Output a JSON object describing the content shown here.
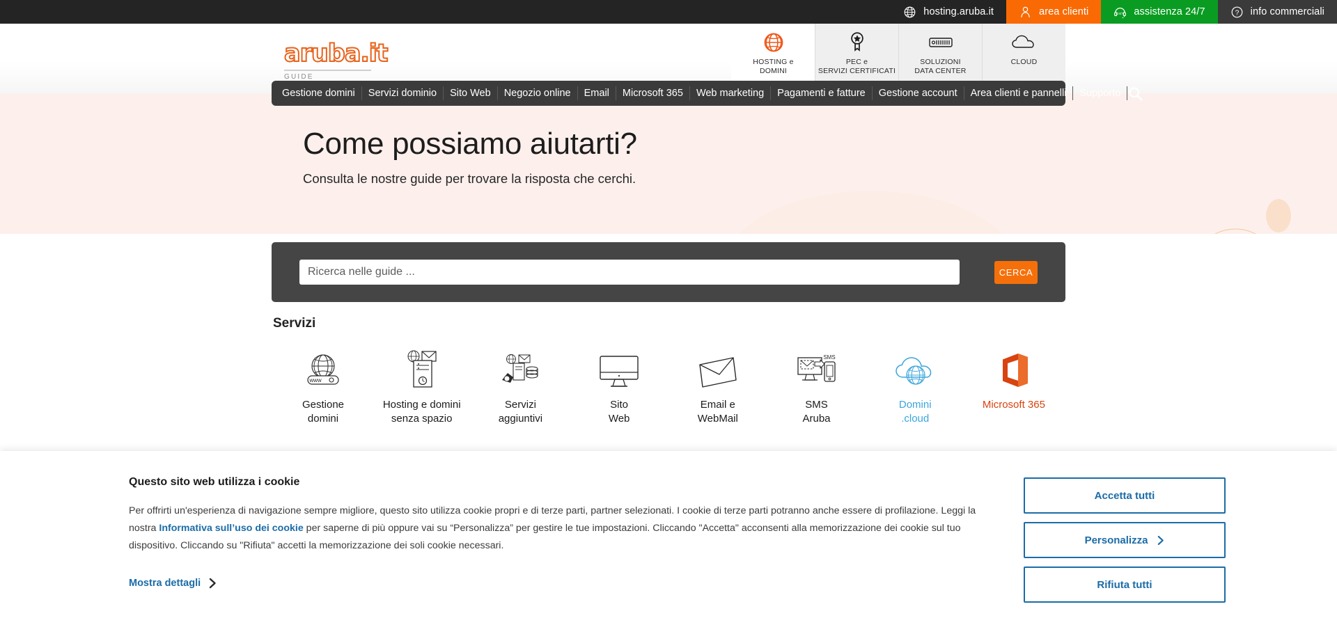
{
  "topbar": {
    "items": [
      {
        "label": "hosting.aruba.it",
        "icon": "globe-icon",
        "style": "tb-dark"
      },
      {
        "label": "area clienti",
        "icon": "user-icon",
        "style": "tb-orange"
      },
      {
        "label": "assistenza 24/7",
        "icon": "headset-icon",
        "style": "tb-green"
      },
      {
        "label": "info commerciali",
        "icon": "question-icon",
        "style": "tb-dark2"
      }
    ]
  },
  "header": {
    "logo": "aruba.it",
    "logo_subtitle": "GUIDE",
    "categories": [
      {
        "line1": "HOSTING e",
        "line2": "DOMINI",
        "icon": "globe-grid-icon",
        "active": true
      },
      {
        "line1": "PEC e",
        "line2": "SERVIZI CERTIFICATI",
        "icon": "seal-star-icon",
        "active": false
      },
      {
        "line1": "SOLUZIONI",
        "line2": "DATA CENTER",
        "icon": "server-rack-icon",
        "active": false
      },
      {
        "line1": "CLOUD",
        "line2": "",
        "icon": "cloud-icon",
        "active": false
      }
    ]
  },
  "menu": {
    "items": [
      "Gestione domini",
      "Servizi dominio",
      "Sito Web",
      "Negozio online",
      "Email",
      "Microsoft 365",
      "Web marketing",
      "Pagamenti e fatture",
      "Gestione account",
      "Area clienti e pannelli",
      "Supporto"
    ],
    "search_icon": "search-icon"
  },
  "hero": {
    "title": "Come possiamo aiutarti?",
    "subtitle": "Consulta le nostre guide per trovare la risposta che cerchi."
  },
  "search": {
    "placeholder": "Ricerca nelle guide ...",
    "value": "",
    "button_label": "CERCA"
  },
  "services": {
    "title": "Servizi",
    "items": [
      {
        "line1": "Gestione",
        "line2": "domini",
        "icon": "globe-www-icon",
        "color": ""
      },
      {
        "line1": "Hosting e domini",
        "line2": "senza spazio",
        "icon": "server-mail-icon",
        "color": ""
      },
      {
        "line1": "Servizi",
        "line2": "aggiuntivi",
        "icon": "services-mix-icon",
        "color": ""
      },
      {
        "line1": "Sito",
        "line2": "Web",
        "icon": "monitor-icon",
        "color": ""
      },
      {
        "line1": "Email e",
        "line2": "WebMail",
        "icon": "envelope-icon",
        "color": ""
      },
      {
        "line1": "SMS",
        "line2": "Aruba",
        "icon": "sms-phone-icon",
        "color": ""
      },
      {
        "line1": "Domini",
        "line2": ".cloud",
        "icon": "cloud-globe-icon",
        "color": "blue"
      },
      {
        "line1": "Microsoft 365",
        "line2": "",
        "icon": "office-logo-icon",
        "color": "orange"
      }
    ]
  },
  "cookie": {
    "title": "Questo sito web utilizza i cookie",
    "body_part1": "Per offrirti un'esperienza di navigazione sempre migliore, questo sito utilizza cookie propri e di terze parti, partner selezionati. I cookie di terze parti potranno anche essere di profilazione. Leggi la nostra ",
    "link_text": "Informativa sull’uso dei cookie",
    "body_part2": " per saperne di più oppure vai su “Personalizza” per gestire le tue impostazioni. Cliccando \"Accetta\" acconsenti alla memorizzazione dei cookie sul tuo dispositivo. Cliccando su \"Rifiuta\" accetti la memorizzazione dei soli cookie necessari.",
    "details_label": "Mostra dettagli",
    "buttons": [
      {
        "label": "Accetta tutti",
        "chevron": false
      },
      {
        "label": "Personalizza",
        "chevron": true
      },
      {
        "label": "Rifiuta tutti",
        "chevron": false
      }
    ]
  },
  "colors": {
    "orange": "#f5700a",
    "green": "#0a9c22",
    "dark": "#242424",
    "hero_bg": "#fdf0ec",
    "link_blue": "#1b6ca8",
    "cloud_blue": "#3aa5dd",
    "ms_orange": "#d8430f"
  }
}
